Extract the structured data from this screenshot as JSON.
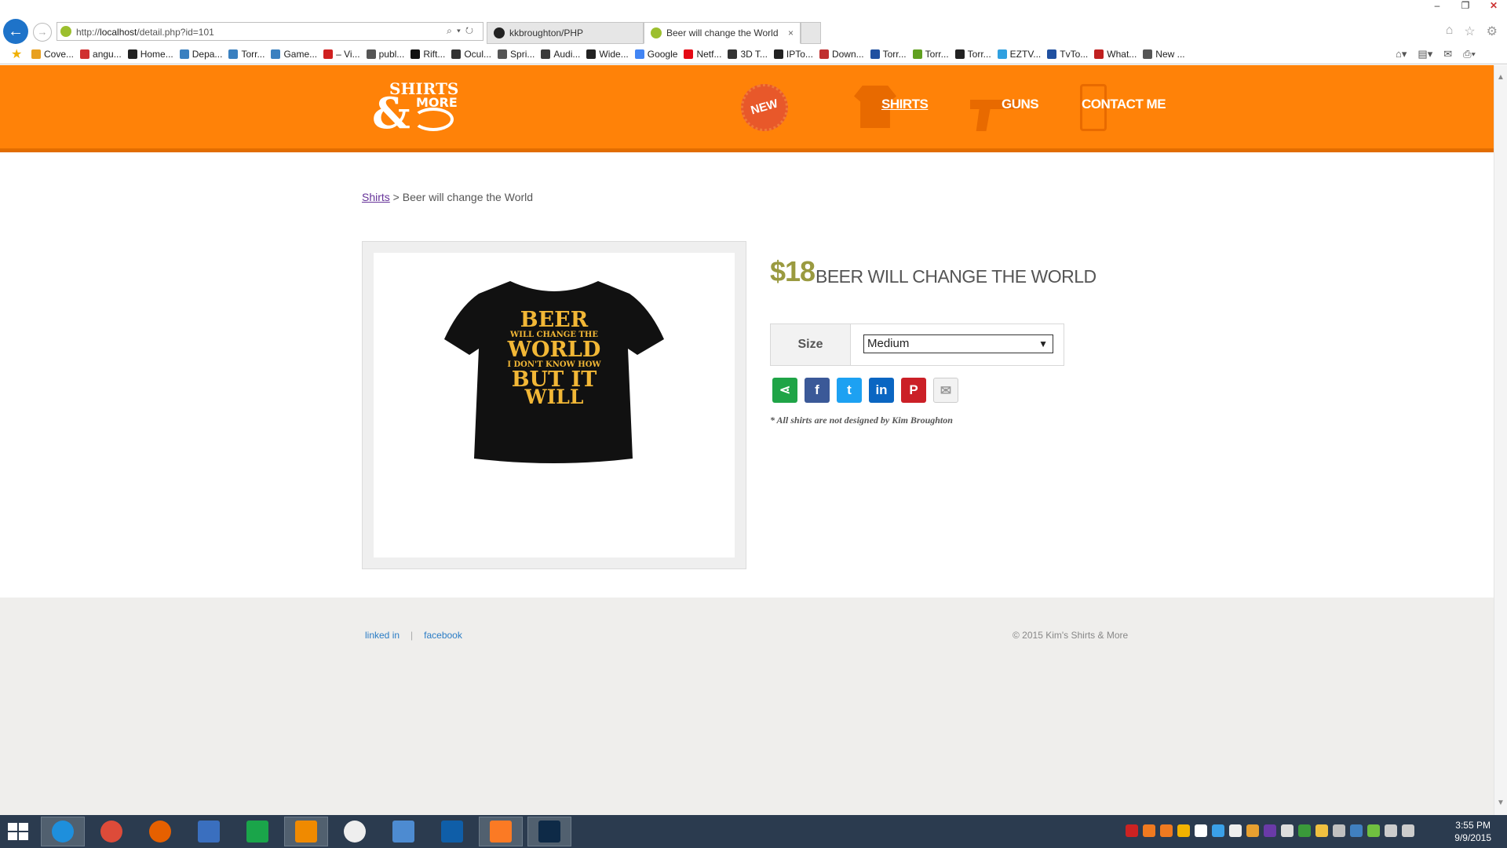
{
  "browser": {
    "url_prefix": "http://",
    "url_host": "localhost",
    "url_path": "/detail.php?id=101",
    "tabs": [
      {
        "label": "kkbroughton/PHP"
      },
      {
        "label": "Beer will change the World"
      }
    ],
    "tab_close": "×",
    "favorites": [
      "Cove...",
      "angu...",
      "Home...",
      "Depa...",
      "Torr...",
      "Game...",
      "– Vi...",
      "publ...",
      "Rift...",
      "Ocul...",
      "Spri...",
      "Audi...",
      "Wide...",
      "Google",
      "Netf...",
      "3D T...",
      "IPTo...",
      "Down...",
      "Torr...",
      "Torr...",
      "Torr...",
      "EZTV...",
      "TvTo...",
      "What...",
      "New ..."
    ]
  },
  "site": {
    "logo": {
      "line1": "SHIRTS",
      "amp": "&",
      "line2": "MORE"
    },
    "nav": {
      "new_badge": "NEW",
      "shirts": "SHIRTS",
      "guns": "GUNS",
      "contact": "CONTACT ME"
    },
    "breadcrumb": {
      "parent": "Shirts",
      "separator": " > ",
      "current": "Beer will change the World"
    },
    "product": {
      "price": "$18",
      "name": "BEER WILL CHANGE THE WORLD",
      "size_label": "Size",
      "size_selected": "Medium",
      "shirt_text": [
        "BEER",
        "WILL CHANGE THE",
        "WORLD",
        "I DON'T KNOW HOW",
        "BUT IT",
        "WILL"
      ],
      "note": "* All shirts are not designed by Kim Broughton",
      "shirt_color": "#111111",
      "print_color": "#f2b736"
    },
    "footer": {
      "links": [
        "linked in",
        "facebook"
      ],
      "separator": "|",
      "copyright": "© 2015 Kim's Shirts & More"
    },
    "colors": {
      "header": "#ff8208",
      "price": "#9a9a40"
    }
  },
  "taskbar": {
    "time": "3:55 PM",
    "date": "9/9/2015"
  }
}
